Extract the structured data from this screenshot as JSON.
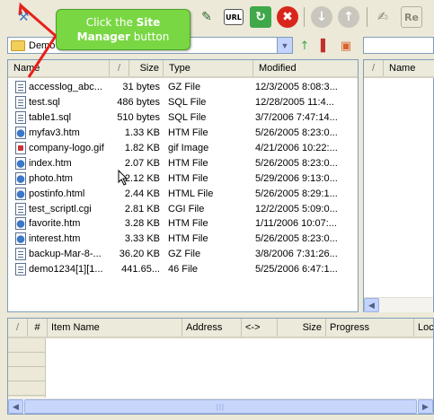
{
  "toolbar": {
    "buttons": [
      {
        "icon": "site-manager-icon",
        "glyph": "⚒"
      },
      {
        "icon": "wand-icon",
        "glyph": "✎"
      },
      {
        "icon": "url-icon",
        "glyph": "URL"
      },
      {
        "icon": "refresh-icon",
        "glyph": "↻"
      },
      {
        "icon": "stop-icon",
        "glyph": "✖"
      },
      {
        "icon": "download-icon",
        "glyph": "↓"
      },
      {
        "icon": "upload-icon",
        "glyph": "↑"
      },
      {
        "icon": "edit-icon",
        "glyph": "✍"
      },
      {
        "icon": "rename-icon",
        "glyph": "Re"
      }
    ]
  },
  "callout": {
    "line1_prefix": "Click the ",
    "line1_bold": "Site",
    "line2_bold": "Manager",
    "line2_suffix": " button"
  },
  "local_path": {
    "value": "Demo",
    "drop_glyph": "▼"
  },
  "file_list": {
    "columns": [
      "Name",
      "/",
      "Size",
      "Type",
      "Modified"
    ],
    "rows": [
      {
        "name": "accesslog_abc...",
        "size": "31 bytes",
        "type": "GZ File",
        "modified": "12/3/2005 8:08:3...",
        "icon": "gz"
      },
      {
        "name": "test.sql",
        "size": "486 bytes",
        "type": "SQL File",
        "modified": "12/28/2005 11:4...",
        "icon": "sql"
      },
      {
        "name": "table1.sql",
        "size": "510 bytes",
        "type": "SQL File",
        "modified": "3/7/2006 7:47:14...",
        "icon": "sql"
      },
      {
        "name": "myfav3.htm",
        "size": "1.33 KB",
        "type": "HTM File",
        "modified": "5/26/2005 8:23:0...",
        "icon": "htm"
      },
      {
        "name": "company-logo.gif",
        "size": "1.82 KB",
        "type": "gif Image",
        "modified": "4/21/2006 10:22:...",
        "icon": "gif"
      },
      {
        "name": "index.htm",
        "size": "2.07 KB",
        "type": "HTM File",
        "modified": "5/26/2005 8:23:0...",
        "icon": "htm"
      },
      {
        "name": "photo.htm",
        "size": "2.12 KB",
        "type": "HTM File",
        "modified": "5/29/2006 9:13:0...",
        "icon": "htm"
      },
      {
        "name": "postinfo.html",
        "size": "2.44 KB",
        "type": "HTML File",
        "modified": "5/26/2005 8:29:1...",
        "icon": "htm"
      },
      {
        "name": "test_scriptl.cgi",
        "size": "2.81 KB",
        "type": "CGI File",
        "modified": "12/2/2005 5:09:0...",
        "icon": "cgi"
      },
      {
        "name": "favorite.htm",
        "size": "3.28 KB",
        "type": "HTM File",
        "modified": "1/11/2006 10:07:...",
        "icon": "htm"
      },
      {
        "name": "interest.htm",
        "size": "3.33 KB",
        "type": "HTM File",
        "modified": "5/26/2005 8:23:0...",
        "icon": "htm"
      },
      {
        "name": "backup-Mar-8-...",
        "size": "36.20 KB",
        "type": "GZ File",
        "modified": "3/8/2006 7:31:26...",
        "icon": "gz"
      },
      {
        "name": "demo1234[1][1...",
        "size": "441.65...",
        "type": "46 File",
        "modified": "5/25/2006 6:47:1...",
        "icon": "d46"
      }
    ]
  },
  "remote_list": {
    "columns": [
      "/",
      "Name"
    ]
  },
  "queue": {
    "columns": [
      "/",
      "#",
      "Item Name",
      "Address",
      "<->",
      "Size",
      "Progress",
      "Loc"
    ]
  },
  "scroll": {
    "left_glyph": "◀",
    "right_glyph": "▶",
    "grip": "|||"
  },
  "colors": {
    "callout": "#79d743",
    "arrow": "#e8201a"
  }
}
